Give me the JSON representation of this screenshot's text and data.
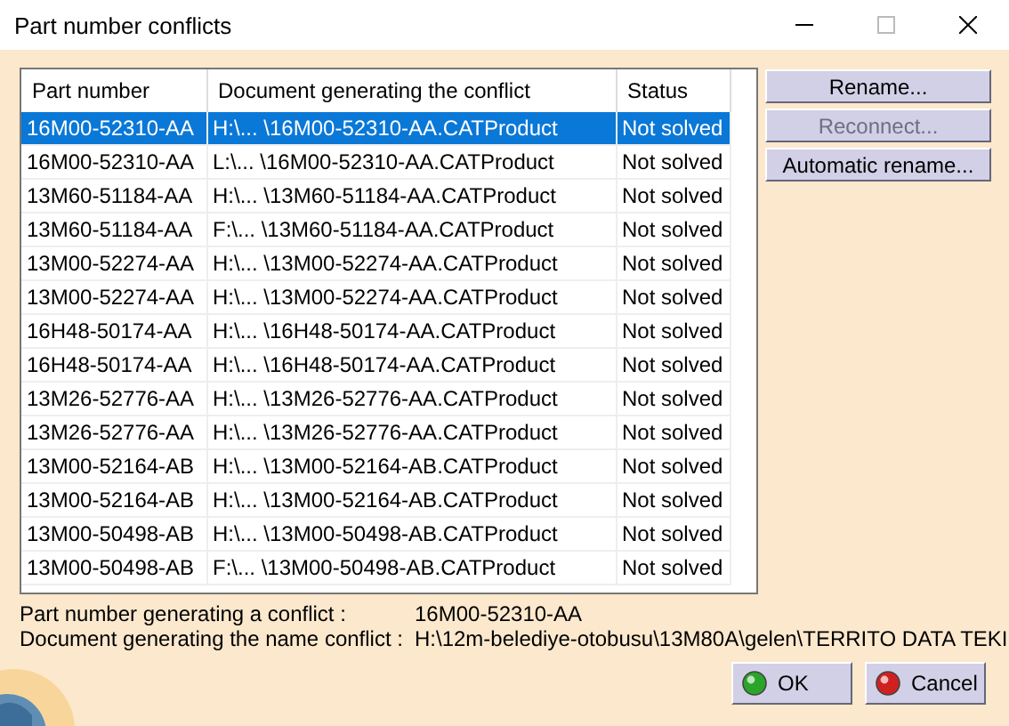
{
  "window": {
    "title": "Part number conflicts"
  },
  "table": {
    "columns": [
      "Part number",
      "Document generating the conflict",
      "Status"
    ],
    "rows": [
      {
        "part": "16M00-52310-AA",
        "document": "H:\\... \\16M00-52310-AA.CATProduct",
        "status": "Not solved",
        "selected": true
      },
      {
        "part": "16M00-52310-AA",
        "document": "L:\\... \\16M00-52310-AA.CATProduct",
        "status": "Not solved",
        "selected": false
      },
      {
        "part": "13M60-51184-AA",
        "document": "H:\\... \\13M60-51184-AA.CATProduct",
        "status": "Not solved",
        "selected": false
      },
      {
        "part": "13M60-51184-AA",
        "document": "F:\\... \\13M60-51184-AA.CATProduct",
        "status": "Not solved",
        "selected": false
      },
      {
        "part": "13M00-52274-AA",
        "document": "H:\\... \\13M00-52274-AA.CATProduct",
        "status": "Not solved",
        "selected": false
      },
      {
        "part": "13M00-52274-AA",
        "document": "H:\\... \\13M00-52274-AA.CATProduct",
        "status": "Not solved",
        "selected": false
      },
      {
        "part": "16H48-50174-AA",
        "document": "H:\\... \\16H48-50174-AA.CATProduct",
        "status": "Not solved",
        "selected": false
      },
      {
        "part": "16H48-50174-AA",
        "document": "H:\\... \\16H48-50174-AA.CATProduct",
        "status": "Not solved",
        "selected": false
      },
      {
        "part": "13M26-52776-AA",
        "document": "H:\\... \\13M26-52776-AA.CATProduct",
        "status": "Not solved",
        "selected": false
      },
      {
        "part": "13M26-52776-AA",
        "document": "H:\\... \\13M26-52776-AA.CATProduct",
        "status": "Not solved",
        "selected": false
      },
      {
        "part": "13M00-52164-AB",
        "document": "H:\\... \\13M00-52164-AB.CATProduct",
        "status": "Not solved",
        "selected": false
      },
      {
        "part": "13M00-52164-AB",
        "document": "H:\\... \\13M00-52164-AB.CATProduct",
        "status": "Not solved",
        "selected": false
      },
      {
        "part": "13M00-50498-AB",
        "document": "H:\\... \\13M00-50498-AB.CATProduct",
        "status": "Not solved",
        "selected": false
      },
      {
        "part": "13M00-50498-AB",
        "document": "F:\\... \\13M00-50498-AB.CATProduct",
        "status": "Not solved",
        "selected": false
      }
    ]
  },
  "side_buttons": [
    {
      "label": "Rename...",
      "disabled": false
    },
    {
      "label": "Reconnect...",
      "disabled": true
    },
    {
      "label": "Automatic rename...",
      "disabled": false
    }
  ],
  "info": [
    {
      "label": "Part number generating a conflict :",
      "value": "16M00-52310-AA"
    },
    {
      "label": "Document generating the name conflict :",
      "value": "H:\\12m-belediye-otobusu\\13M80A\\gelen\\TERRITO DATA TEKI"
    }
  ],
  "buttons": [
    {
      "label": "OK",
      "kind": "ok"
    },
    {
      "label": "Cancel",
      "kind": "cancel"
    }
  ]
}
